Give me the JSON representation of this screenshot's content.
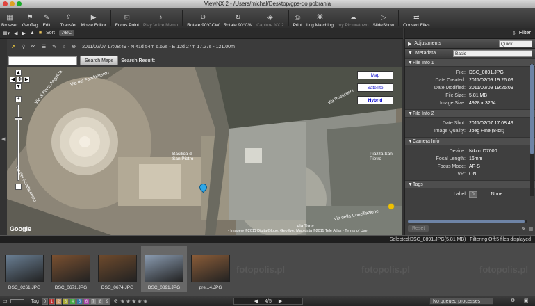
{
  "window": {
    "title": "ViewNX 2 - /Users/michal/Desktop/gps-do pobrania"
  },
  "toolbar": {
    "items": [
      {
        "label": "Browser",
        "icon": "grid-icon",
        "enabled": true
      },
      {
        "label": "GeoTag",
        "icon": "geotag-icon",
        "enabled": true
      },
      {
        "label": "Edit",
        "icon": "edit-icon",
        "enabled": true
      },
      {
        "label": "Transfer",
        "icon": "transfer-icon",
        "enabled": true
      },
      {
        "label": "Movie Editor",
        "icon": "movie-icon",
        "enabled": true
      },
      {
        "label": "Focus Point",
        "icon": "focus-icon",
        "enabled": true
      },
      {
        "label": "Play Voice Memo",
        "icon": "voice-icon",
        "enabled": false
      },
      {
        "label": "Rotate 90°CCW",
        "icon": "rotate-ccw-icon",
        "enabled": true
      },
      {
        "label": "Rotate 90°CW",
        "icon": "rotate-cw-icon",
        "enabled": true
      },
      {
        "label": "Capture NX 2",
        "icon": "capture-icon",
        "enabled": false
      },
      {
        "label": "Print",
        "icon": "print-icon",
        "enabled": true
      },
      {
        "label": "Log Matching",
        "icon": "log-icon",
        "enabled": true
      },
      {
        "label": "my Picturetown",
        "icon": "picturetown-icon",
        "enabled": false
      },
      {
        "label": "SlideShow",
        "icon": "slideshow-icon",
        "enabled": true
      },
      {
        "label": "Convert Files",
        "icon": "convert-icon",
        "enabled": true
      }
    ]
  },
  "subbar": {
    "sort_label": "Sort",
    "abc_label": "ABC",
    "filter_label": "Filter"
  },
  "map": {
    "coords": "2011/02/07 17:08:49 - N 41d 54m 6.62s - E 12d 27m 17.27s - 121.00m",
    "search_placeholder": "",
    "search_button": "Search Maps",
    "search_result_label": "Search Result:",
    "types": [
      "Map",
      "Satellite",
      "Hybrid"
    ],
    "selected_type": "Hybrid",
    "streets": [
      "Via del Fondamento",
      "Via del Fondamento",
      "Via di Porta Angelica",
      "Via della Conciliazione",
      "Via Tonc...",
      "Via Rusticucci",
      "Piazza San Pietro",
      "Basilica di San Pietro"
    ],
    "copyright": "- Imagery ©2011 DigitalGlobe, GeoEye, Map data ©2011 Tele Atlas - Terms of Use",
    "logo": "Google"
  },
  "panel": {
    "adjustments_label": "Adjustments",
    "adjustments_mode": "Quick",
    "metadata_label": "Metadata",
    "metadata_mode": "Basic",
    "sections": [
      {
        "title": "File Info 1",
        "rows": [
          {
            "k": "File:",
            "v": "DSC_0891.JPG"
          },
          {
            "k": "Date Created:",
            "v": "2011/02/09 19:26:09"
          },
          {
            "k": "Date Modified:",
            "v": "2011/02/09 19:26:09"
          },
          {
            "k": "File Size:",
            "v": "5.81 MB"
          },
          {
            "k": "Image Size:",
            "v": "4928 x 3264"
          }
        ]
      },
      {
        "title": "File Info 2",
        "rows": [
          {
            "k": "Date Shot:",
            "v": "2011/02/07 17:08:49..."
          },
          {
            "k": "Image Quality:",
            "v": "Jpeg Fine (8-bit)"
          }
        ]
      },
      {
        "title": "Camera Info",
        "rows": [
          {
            "k": "Device:",
            "v": "Nikon D7000"
          },
          {
            "k": "Focal Length:",
            "v": "16mm"
          },
          {
            "k": "Focus Mode:",
            "v": "AF-S"
          },
          {
            "k": "VR:",
            "v": "ON"
          }
        ]
      },
      {
        "title": "Tags",
        "rows": [
          {
            "k": "Label",
            "v": "None"
          }
        ]
      }
    ],
    "label_value": "0",
    "reset_button": "Reset"
  },
  "status": {
    "text": "Selected:DSC_0891.JPG(5.81 MB) | Filtering Off:5 files displayed"
  },
  "filmstrip": {
    "items": [
      {
        "name": "DSC_0261.JPG",
        "color": "#6a7f94",
        "selected": false
      },
      {
        "name": "DSC_0671.JPG",
        "color": "#7a5030",
        "selected": false
      },
      {
        "name": "DSC_0674.JPG",
        "color": "#6e4a2c",
        "selected": false
      },
      {
        "name": "DSC_0891.JPG",
        "color": "#8a9bb0",
        "selected": true
      },
      {
        "name": "pre...4.JPG",
        "color": "#8a5c38",
        "selected": false
      }
    ],
    "watermark": "fotopolis.pl"
  },
  "bottom": {
    "tag_label": "Tag",
    "labels": [
      "0",
      "1",
      "2",
      "3",
      "4",
      "5",
      "6",
      "7",
      "8",
      "9"
    ],
    "label_colors": [
      "#555",
      "#b33",
      "#c96",
      "#aa3",
      "#4a4",
      "#37a",
      "#a4a",
      "#888",
      "#777",
      "#666"
    ],
    "page": "4/5",
    "queue": "No queued processes"
  }
}
